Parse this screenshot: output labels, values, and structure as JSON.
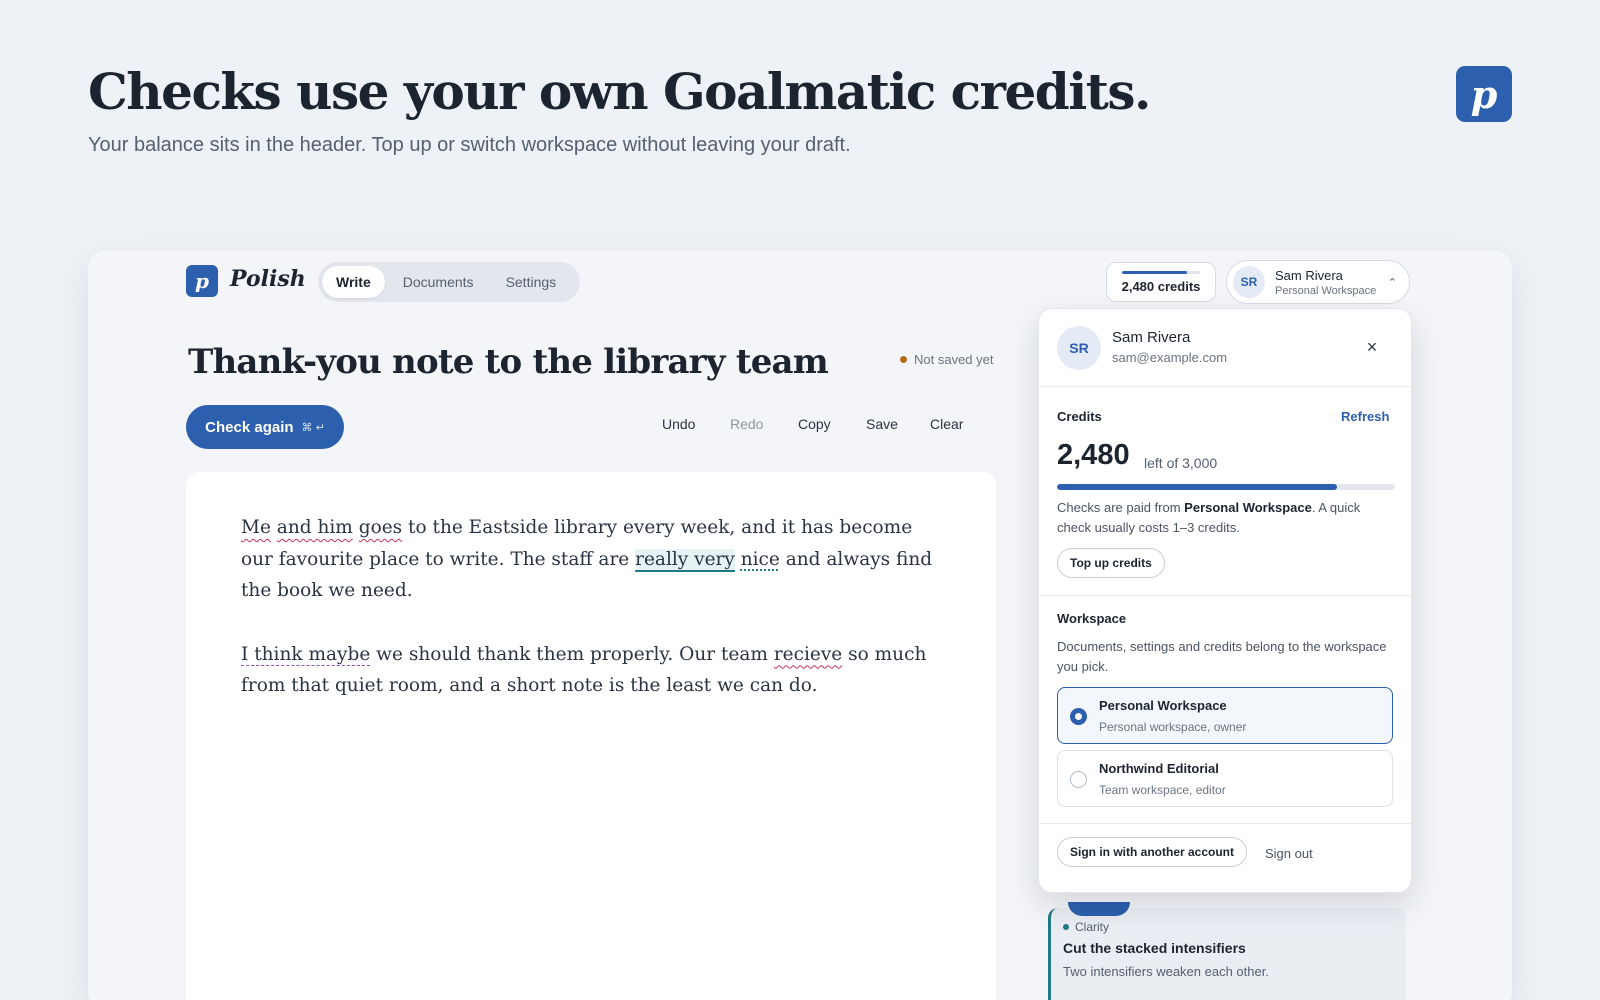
{
  "hero": {
    "title": "Checks use your own Goalmatic credits.",
    "subtitle": "Your balance sits in the header. Top up or switch workspace without leaving your draft.",
    "logo_glyph": "p"
  },
  "app": {
    "logo_glyph": "p",
    "name": "Polish",
    "nav": [
      {
        "label": "Write",
        "active": true
      },
      {
        "label": "Documents",
        "active": false
      },
      {
        "label": "Settings",
        "active": false
      }
    ],
    "credits_label": "2,480 credits",
    "credits_fraction": 0.827,
    "account": {
      "initials": "SR",
      "name": "Sam Rivera",
      "workspace": "Personal Workspace"
    }
  },
  "document": {
    "title": "Thank-you note to the library team",
    "save_status": "Not saved yet",
    "check_button": "Check again",
    "check_shortcut": "⌘ ↵",
    "toolbar": {
      "undo": "Undo",
      "redo": "Redo",
      "copy": "Copy",
      "save": "Save",
      "clear": "Clear"
    },
    "p1": {
      "e1": "Me",
      "t1": " ",
      "e2": "and him",
      "t2": " ",
      "e3": "goes",
      "t3": " to the Eastside library every week, and it has become our favourite place to write. The staff are ",
      "e4": "really very",
      "t4": " ",
      "e5": "nice",
      "t5": " and always find the book we need."
    },
    "p2": {
      "e1": "I think maybe",
      "t1": " we should thank them properly. Our team ",
      "e2": "recieve",
      "t2": " so much from that quiet room, and a short note is the least we can do."
    }
  },
  "suggestion": {
    "category": "Clarity",
    "title": "Cut the stacked intensifiers",
    "body": "Two intensifiers weaken each other."
  },
  "popover": {
    "initials": "SR",
    "name": "Sam Rivera",
    "email": "sam@example.com",
    "close_icon": "×",
    "credits_label": "Credits",
    "refresh": "Refresh",
    "balance": "2,480",
    "balance_of": "left of 3,000",
    "balance_fraction": 0.827,
    "paid_prefix": "Checks are paid from ",
    "paid_workspace": "Personal Workspace",
    "paid_suffix": ". A quick check usually costs 1–3 credits.",
    "topup": "Top up credits",
    "workspace_label": "Workspace",
    "workspace_desc": "Documents, settings and credits belong to the workspace you pick.",
    "workspaces": [
      {
        "name": "Personal Workspace",
        "sub": "Personal workspace, owner",
        "selected": true
      },
      {
        "name": "Northwind Editorial",
        "sub": "Team workspace, editor",
        "selected": false
      }
    ],
    "switch_account": "Sign in with another account",
    "sign_out": "Sign out"
  },
  "colors": {
    "brand": "#2c5fad",
    "spelling": "#c6335a",
    "clarity": "#1f7a86",
    "style": "#8a4fc4",
    "unsaved": "#b56a16"
  }
}
